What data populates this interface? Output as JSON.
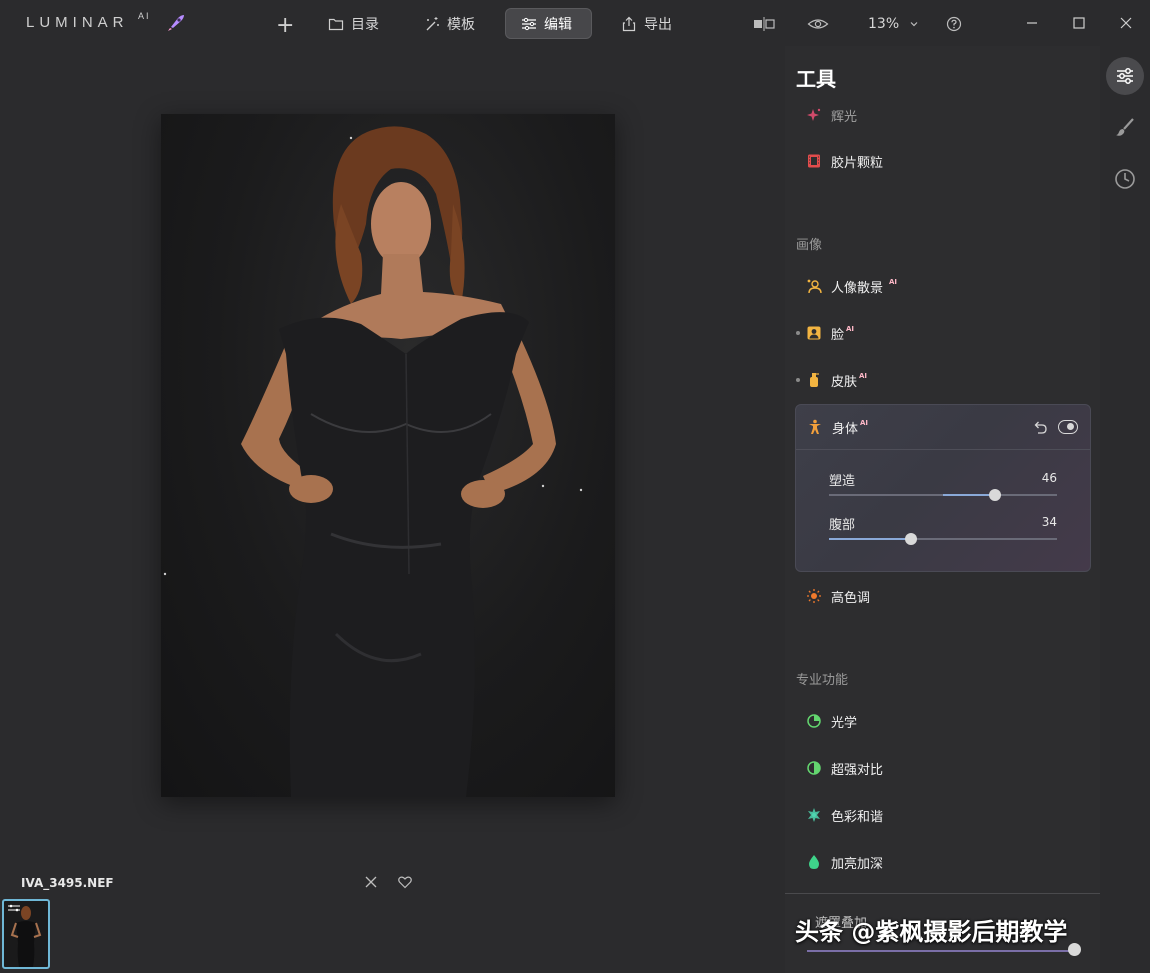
{
  "app": {
    "logo": "LUMINAR",
    "logo_suffix": "AI"
  },
  "toolbar": {
    "plus": "+",
    "catalog": "目录",
    "templates": "模板",
    "edit": "编辑",
    "export": "导出",
    "zoom": "13%"
  },
  "canvas": {
    "filename": "IVA_3495.NEF"
  },
  "panel": {
    "title": "工具",
    "tools_top": [
      {
        "label": "辉光",
        "icon": "sparkle-icon"
      },
      {
        "label": "胶片颗粒",
        "icon": "film-icon"
      }
    ],
    "section_portrait": "画像",
    "portrait_tools": [
      {
        "label": "人像散景",
        "ai": "AI",
        "icon": "bokeh-icon"
      },
      {
        "label": "脸",
        "ai": "AI",
        "icon": "face-icon"
      },
      {
        "label": "皮肤",
        "ai": "AI",
        "icon": "skin-icon"
      }
    ],
    "body_tool": {
      "label": "身体",
      "ai": "AI",
      "sliders": [
        {
          "label": "塑造",
          "value": "46",
          "fraction": 0.73
        },
        {
          "label": "腹部",
          "value": "34",
          "fraction": 0.36
        }
      ]
    },
    "high_key": "高色调",
    "section_pro": "专业功能",
    "pro_tools": [
      {
        "label": "光学",
        "icon": "optics-icon"
      },
      {
        "label": "超强对比",
        "icon": "contrast-icon"
      },
      {
        "label": "色彩和谐",
        "icon": "color-harmony-icon"
      },
      {
        "label": "加亮加深",
        "icon": "dodge-burn-icon"
      }
    ],
    "bottom_item": "遮罩叠加"
  },
  "watermark": "头条 @紫枫摄影后期教学",
  "colors": {
    "background": "#2b2b2d",
    "panel": "#2d2d2f",
    "accent_edit": "#47474a",
    "thumb_border": "#6fb7d6"
  }
}
